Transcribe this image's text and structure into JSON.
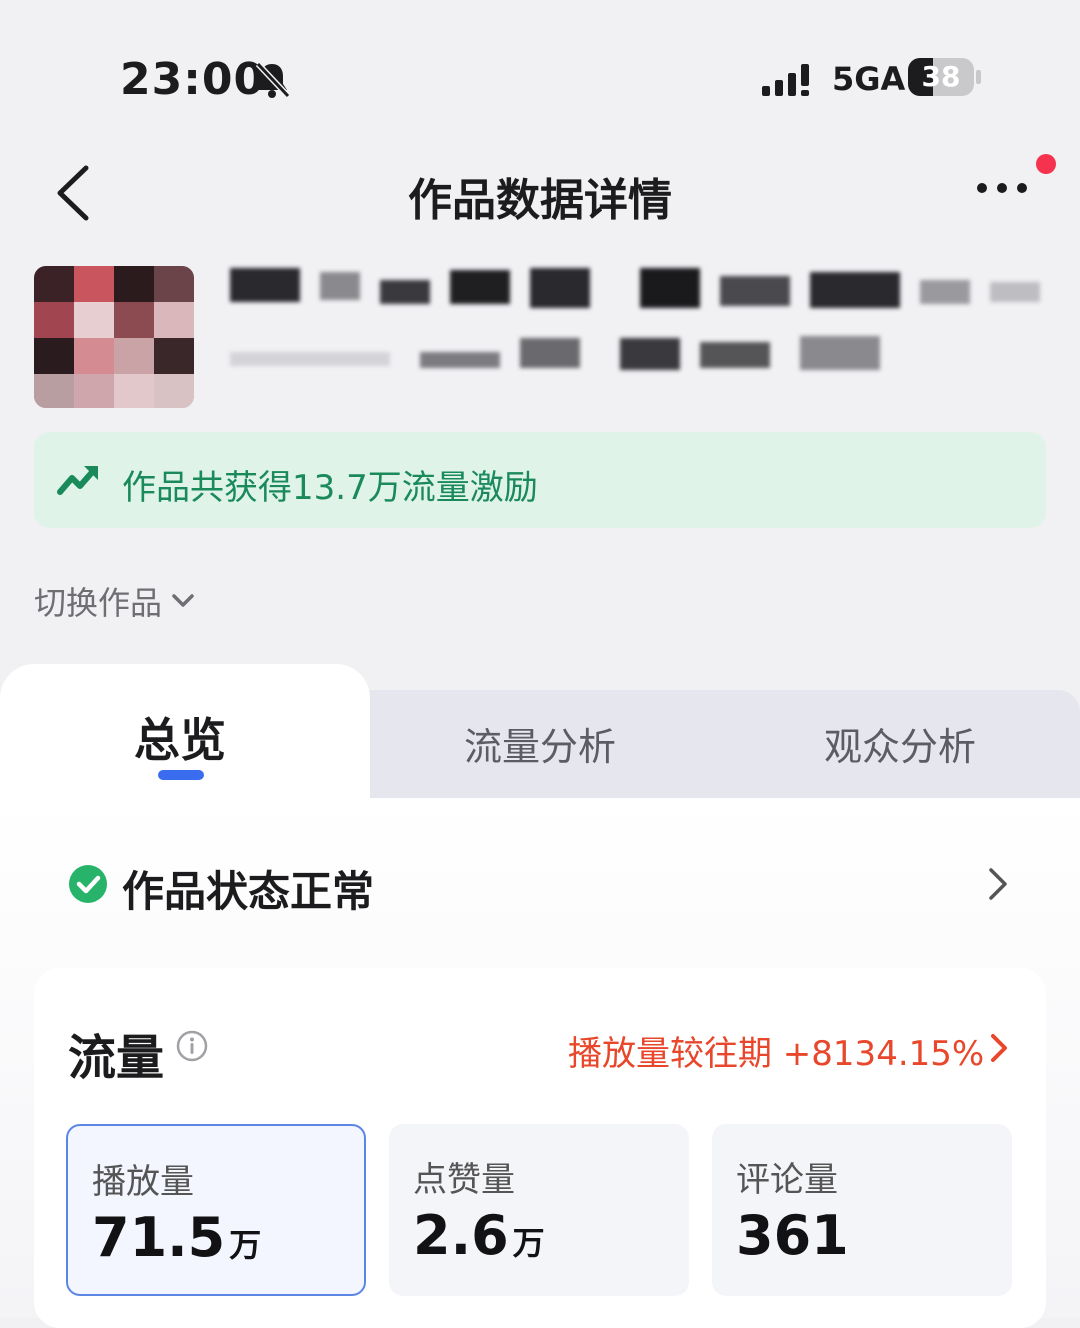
{
  "status_bar": {
    "time": "23:00",
    "network": "5GA",
    "battery": "38",
    "battery_level": 0.38
  },
  "nav": {
    "title": "作品数据详情"
  },
  "incentive": {
    "text": "作品共获得13.7万流量激励"
  },
  "switch_work": {
    "label": "切换作品"
  },
  "tabs": [
    {
      "label": "总览",
      "active": true
    },
    {
      "label": "流量分析",
      "active": false
    },
    {
      "label": "观众分析",
      "active": false
    }
  ],
  "work_status": {
    "text": "作品状态正常"
  },
  "traffic": {
    "title": "流量",
    "compare": "播放量较往期 +8134.15%",
    "metrics": [
      {
        "label": "播放量",
        "value": "71.5",
        "unit": "万",
        "selected": true
      },
      {
        "label": "点赞量",
        "value": "2.6",
        "unit": "万",
        "selected": false
      },
      {
        "label": "评论量",
        "value": "361",
        "unit": "",
        "selected": false
      }
    ]
  },
  "colors": {
    "accent_blue": "#3a6cf0",
    "incentive_green": "#1a8a5a",
    "compare_red": "#e8472b",
    "notice_red": "#f5334f"
  }
}
